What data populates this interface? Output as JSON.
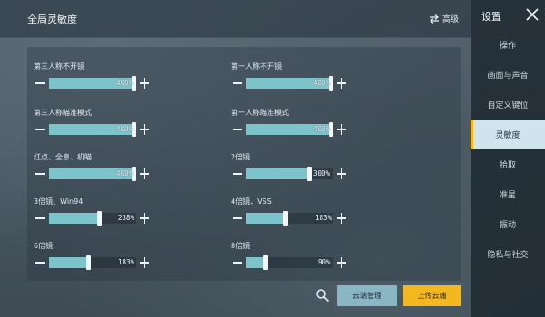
{
  "header": {
    "title": "全局灵敏度",
    "advanced_label": "高级"
  },
  "settings": [
    {
      "label": "第三人称不开镜",
      "value_text": "400%",
      "level": 1.0
    },
    {
      "label": "第一人称不开镜",
      "value_text": "400%",
      "level": 1.0
    },
    {
      "label": "第三人称瞄准模式",
      "value_text": "400%",
      "level": 1.0
    },
    {
      "label": "第一人称瞄准模式",
      "value_text": "400%",
      "level": 1.0
    },
    {
      "label": "红点、全息、机瞄",
      "value_text": "400%",
      "level": 1.0
    },
    {
      "label": "2倍镜",
      "value_text": "300%",
      "level": 0.74
    },
    {
      "label": "3倍镜、Win94",
      "value_text": "238%",
      "level": 0.58
    },
    {
      "label": "4倍镜、VSS",
      "value_text": "183%",
      "level": 0.45
    },
    {
      "label": "6倍镜",
      "value_text": "183%",
      "level": 0.45
    },
    {
      "label": "8倍镜",
      "value_text": "90%",
      "level": 0.21
    }
  ],
  "footer": {
    "cloud_manage_label": "云端管理",
    "upload_cloud_label": "上传云端"
  },
  "sidebar": {
    "title": "设置",
    "items": [
      {
        "label": "操作"
      },
      {
        "label": "画面与声音"
      },
      {
        "label": "自定义键位"
      },
      {
        "label": "灵敏度",
        "active": true
      },
      {
        "label": "拾取"
      },
      {
        "label": "准星"
      },
      {
        "label": "振动"
      },
      {
        "label": "隐私与社交"
      }
    ]
  },
  "colors": {
    "slider_fill": "#7cc3cc",
    "active_nav_bg": "#cfe4ec",
    "accent_yellow": "#f3b81f",
    "cloud_button": "#8ab6c4"
  }
}
